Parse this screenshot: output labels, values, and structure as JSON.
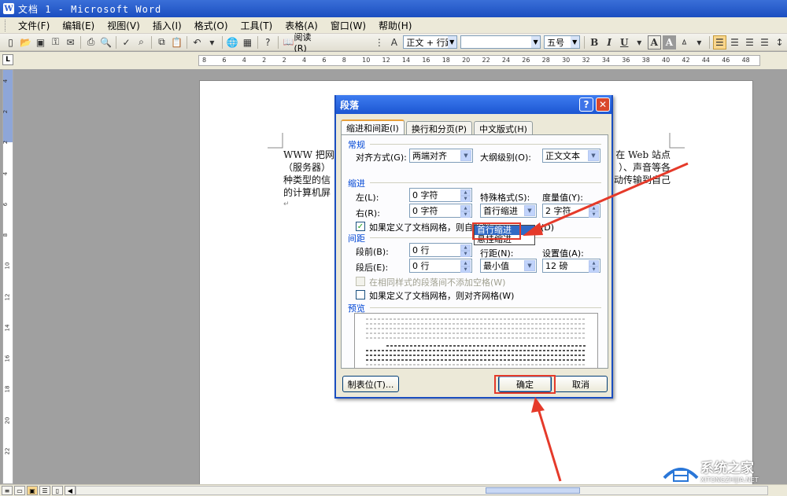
{
  "window": {
    "title": "文档 1 - Microsoft Word",
    "app_icon": "W"
  },
  "menubar": [
    "文件(F)",
    "编辑(E)",
    "视图(V)",
    "插入(I)",
    "格式(O)",
    "工具(T)",
    "表格(A)",
    "窗口(W)",
    "帮助(H)"
  ],
  "toolbar": {
    "read_label": "阅读(R)",
    "style_value": "正文 + 行距",
    "font_value": "",
    "size_value": "五号",
    "bold": "B",
    "italic": "I",
    "underline": "U",
    "font_color": "A",
    "char_shade": "A"
  },
  "ruler": {
    "corner": "L",
    "h_ticks": [
      "8",
      "6",
      "4",
      "2",
      "2",
      "4",
      "6",
      "8",
      "10",
      "12",
      "14",
      "16",
      "18",
      "20",
      "22",
      "24",
      "26",
      "28",
      "30",
      "32",
      "34",
      "36",
      "38",
      "40",
      "42",
      "44",
      "46",
      "48"
    ],
    "v_ticks": [
      "4",
      "2",
      "2",
      "4",
      "6",
      "8",
      "10",
      "12",
      "14",
      "16",
      "18",
      "20",
      "22"
    ]
  },
  "document": {
    "line1_left": "WWW 把网",
    "line1_right": "在 Web 站点",
    "line2_left": "（服务器）",
    "line2_right": "）、声音等各",
    "line3_left": "种类型的信",
    "line3_right": "动传输到自己",
    "line4_left": "的计算机屏",
    "para_mark": "↵"
  },
  "dialog": {
    "title": "段落",
    "help_btn": "?",
    "close_btn": "✕",
    "tabs": [
      "缩进和间距(I)",
      "换行和分页(P)",
      "中文版式(H)"
    ],
    "general": {
      "group": "常规",
      "align_label": "对齐方式(G):",
      "align_value": "两端对齐",
      "outline_label": "大纲级别(O):",
      "outline_value": "正文文本"
    },
    "indent": {
      "group": "缩进",
      "left_label": "左(L):",
      "left_value": "0 字符",
      "right_label": "右(R):",
      "right_value": "0 字符",
      "special_label": "特殊格式(S):",
      "special_value": "首行缩进",
      "by_label": "度量值(Y):",
      "by_value": "2 字符",
      "grid_check_label": "如果定义了文档网格，则自动调",
      "grid_check_tail": "(D)"
    },
    "special_options": [
      "首行缩进",
      "悬挂缩进"
    ],
    "spacing": {
      "group": "间距",
      "before_label": "段前(B):",
      "before_value": "0 行",
      "after_label": "段后(E):",
      "after_value": "0 行",
      "line_label": "行距(N):",
      "line_value": "最小值",
      "at_label": "设置值(A):",
      "at_value": "12 磅",
      "nospace_label": "在相同样式的段落间不添加空格(W)",
      "snap_label": "如果定义了文档网格，则对齐网格(W)"
    },
    "preview": {
      "group": "预览"
    },
    "buttons": {
      "tabs": "制表位(T)...",
      "ok": "确定",
      "cancel": "取消"
    }
  },
  "watermark": {
    "title": "系统之家",
    "url": "XITONGZHIJIA.NET"
  },
  "colors": {
    "accent": "#1c56d2",
    "highlight": "#e53a2a",
    "selection": "#316ac5"
  }
}
